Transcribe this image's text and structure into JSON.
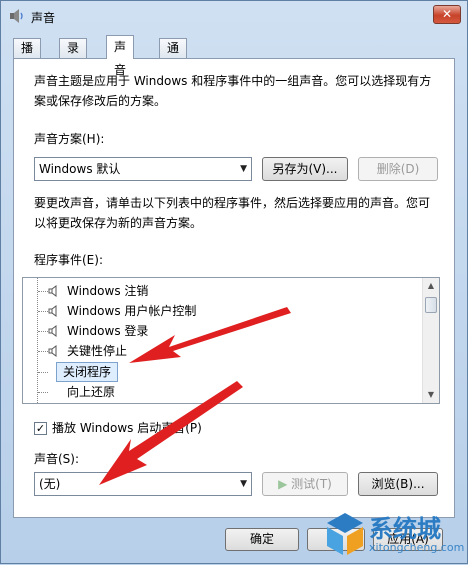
{
  "window": {
    "title": "声音"
  },
  "tabs": [
    {
      "label": "播放"
    },
    {
      "label": "录制"
    },
    {
      "label": "声音"
    },
    {
      "label": "通信"
    }
  ],
  "intro": {
    "line1": "声音主题是应用于 Windows 和程序事件中的一组声音。您可以选择现有方",
    "line2": "案或保存修改后的方案。"
  },
  "scheme": {
    "label": "声音方案(H):",
    "selected": "Windows 默认",
    "save_as": "另存为(V)...",
    "delete": "删除(D)"
  },
  "instructions": {
    "line1": "要更改声音，请单击以下列表中的程序事件，然后选择要应用的声音。您可",
    "line2": "以将更改保存为新的声音方案。"
  },
  "events": {
    "label": "程序事件(E):",
    "items": [
      {
        "label": "Windows 注销"
      },
      {
        "label": "Windows 用户帐户控制"
      },
      {
        "label": "Windows 登录"
      },
      {
        "label": "关键性停止"
      },
      {
        "label": "关闭程序"
      },
      {
        "label": "向上还原"
      }
    ]
  },
  "startup": {
    "label": "播放 Windows 启动声音(P)",
    "checked": true
  },
  "sound": {
    "label": "声音(S):",
    "selected": "(无)",
    "test": "测试(T)",
    "browse": "浏览(B)..."
  },
  "footer": {
    "ok": "确定",
    "apply": "应用(A)"
  },
  "watermark": {
    "text": "系统城",
    "url": "xitongcheng.com"
  }
}
